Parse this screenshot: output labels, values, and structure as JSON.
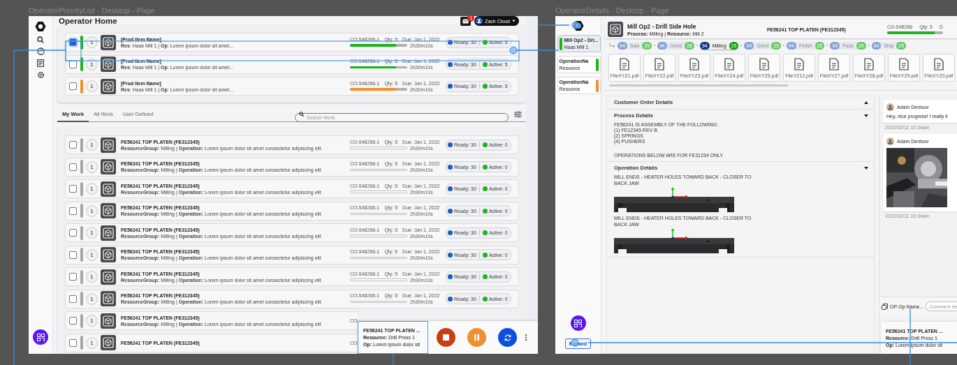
{
  "frames": [
    {
      "title": "OperatorPriorityList - Desktop - Page"
    },
    {
      "title": "OperatorDetails - Desktop - Page"
    }
  ],
  "home": {
    "header": {
      "title": "Operator Home",
      "mail_count": "1",
      "user": "Zach Cloud"
    },
    "priority_items": [
      {
        "checked": true,
        "color": "#1db31d",
        "number": "1",
        "name": "[Prod Item Name]",
        "detail": "**Res**: Haas Mill 1  |  **Op**: Lorem ipsum dolor sit amet...",
        "order": "CO-548266-1",
        "qty": "Qty: 5",
        "due": "Due: Jan 1, 2022",
        "level": 0.8,
        "time": "2h30m10s",
        "ready": "Ready: 30",
        "active": "Active: 5"
      },
      {
        "checked": false,
        "color": "#1db31d",
        "number": "1",
        "name": "[Prod Item Name]",
        "detail": "**Res**: Haas Mill 1  |  **Op**: Lorem ipsum dolor sit amet...",
        "order": "CO-548266-1",
        "qty": "Qty: 5",
        "due": "Due: Jan 1, 2022",
        "level": 0.8,
        "time": "2h30m10s",
        "ready": "Ready: 30",
        "active": "Active: 5"
      },
      {
        "checked": false,
        "color": "#f0902e",
        "number": "1",
        "name": "[Prod Item Name]",
        "detail": "**Res**: Haas Mill 1  |  **Op**: Lorem ipsum dolor sit amet...",
        "order": "CO-548266-1",
        "qty": "Qty: 5",
        "due": "Due: Jan 1, 2022",
        "level": 0.8,
        "time": "2h30m10s",
        "ready": "Ready: 30",
        "active": "Active: 5"
      }
    ],
    "tabs": [
      {
        "label": "My Work",
        "selected": true
      },
      {
        "label": "All Work",
        "selected": false
      },
      {
        "label": "User Defined",
        "selected": false
      }
    ],
    "search": {
      "placeholder": "Search Work"
    },
    "work_rows": [
      {
        "checked": false,
        "color": "#a6a6a6",
        "number": "1",
        "name": "FE56241 TOP PLATEN (FE312345)",
        "detail": "**ResourceGroup:** Milling  |  **Operation:** Lorem ipsum dolor sit amet consectetur adipiscing elit",
        "order": "CO-548266-1",
        "qty": "Qty: 5",
        "due": "Due: Jan 1, 2022",
        "level": 0,
        "time": "2h30m10s",
        "ready": "Ready: 30",
        "active": "Active: 0"
      },
      {
        "checked": false,
        "color": "#a6a6a6",
        "number": "1",
        "name": "FE56241 TOP PLATEN (FE312345)",
        "detail": "**ResourceGroup:** Milling  |  **Operation:** Lorem ipsum dolor sit amet consectetur adipiscing elit",
        "order": "CO-548266-1",
        "qty": "Qty: 5",
        "due": "Due: Jan 1, 2022",
        "level": 0,
        "time": "2h30m10s",
        "ready": "Ready: 30",
        "active": "Active: 0"
      },
      {
        "checked": false,
        "color": "#a6a6a6",
        "number": "1",
        "name": "FE56241 TOP PLATEN (FE312345)",
        "detail": "**ResourceGroup:** Milling  |  **Operation:** Lorem ipsum dolor sit amet consectetur adipiscing elit",
        "order": "CO-548266-1",
        "qty": "Qty: 5",
        "due": "Due: Jan 1, 2022",
        "level": 0,
        "time": "2h30m10s",
        "ready": "Ready: 30",
        "active": "Active: 0"
      },
      {
        "checked": false,
        "color": "#a6a6a6",
        "number": "1",
        "name": "FE56241 TOP PLATEN (FE312345)",
        "detail": "**ResourceGroup:** Milling  |  **Operation:** Lorem ipsum dolor sit amet consectetur adipiscing elit",
        "order": "CO-548266-1",
        "qty": "Qty: 5",
        "due": "Due: Jan 1, 2022",
        "level": 0,
        "time": "2h30m10s",
        "ready": "Ready: 30",
        "active": "Active: 0"
      },
      {
        "checked": false,
        "color": "#a6a6a6",
        "number": "1",
        "name": "FE56241 TOP PLATEN (FE312345)",
        "detail": "**ResourceGroup:** Milling  |  **Operation:** Lorem ipsum dolor sit amet consectetur adipiscing elit",
        "order": "CO-548266-1",
        "qty": "Qty: 5",
        "due": "Due: Jan 1, 2022",
        "level": 0,
        "time": "2h30m10s",
        "ready": "Ready: 30",
        "active": "Active: 0"
      },
      {
        "checked": false,
        "color": "#a6a6a6",
        "number": "1",
        "name": "FE56241 TOP PLATEN (FE312345)",
        "detail": "**ResourceGroup:** Milling  |  **Operation:** Lorem ipsum dolor sit amet consectetur adipiscing elit",
        "order": "CO-548266-1",
        "qty": "Qty: 5",
        "due": "Due: Jan 1, 2022",
        "level": 0,
        "time": "2h30m10s",
        "ready": "Ready: 30",
        "active": "Active: 0"
      },
      {
        "checked": false,
        "color": "#a6a6a6",
        "number": "1",
        "name": "FE56241 TOP PLATEN (FE312345)",
        "detail": "**ResourceGroup:** Milling  |  **Operation:** Lorem ipsum dolor sit amet consectetur adipiscing elit",
        "order": "CO-548266-1",
        "qty": "Qty: 5",
        "due": "Due: Jan 1, 2022",
        "level": 0,
        "time": "2h30m10s",
        "ready": "Ready: 30",
        "active": "Active: 0"
      },
      {
        "checked": false,
        "color": "#a6a6a6",
        "number": "1",
        "name": "FE56241 TOP PLATEN (FE312345)",
        "detail": "**ResourceGroup:** Milling  |  **Operation:** Lorem ipsum dolor sit amet consectetur adipiscing elit",
        "order": "CO-548266-1",
        "qty": "Qty: 5",
        "due": "Due: Jan 1, 2022",
        "level": 0,
        "time": "2h30m10s",
        "ready": "Ready: 30",
        "active": "Active: 0"
      },
      {
        "checked": false,
        "color": "#a6a6a6",
        "number": "1",
        "name": "FE56241 TOP PLATEN (FE312345)",
        "detail": "**ResourceGroup:** Milling  |  **Operation:** Lorem ipsum dolor sit amet consectetur adipiscing elit",
        "order": "CO"
      },
      {
        "checked": false,
        "color": "#a6a6a6",
        "number": "1",
        "name": "FE56241 TOP PLATEN (FE312345)",
        "order": "CO"
      }
    ],
    "active_job": {
      "title": "FE56241 TOP PLATEN ...",
      "resource": "**Resource:** Drill Press 1",
      "op": "**Op:** Lorem ipsum dolor sit"
    }
  },
  "details": {
    "operations": [
      {
        "title": "Mill Op2 - Dri...",
        "subtitle": "Haas Mill 1",
        "color": "#1db31d",
        "selected": true
      },
      {
        "title": "OperationNa",
        "subtitle": "Resource",
        "color": "#1db31d",
        "selected": false
      },
      {
        "title": "OperationNa",
        "subtitle": "Resource",
        "color": "#f0902e",
        "selected": false
      }
    ],
    "expand_label": "Expand",
    "header": {
      "title": "Mill Op2 - Drill Side Hole",
      "subtitle": "**Process:** Milling    |    **Resource:** Mill 2",
      "part": "FE56241 TOP PLATEN (FE312345)",
      "order": "CO-548266",
      "qty": "Qty: 5",
      "due": "D",
      "level": 0.85
    },
    "steps": [
      {
        "count": "94",
        "name": "Saw",
        "done": "25",
        "selected": false
      },
      {
        "count": "94",
        "name": "Grind",
        "done": "25",
        "selected": false
      },
      {
        "count": "94",
        "name": "Milling",
        "done": "25",
        "selected": true
      },
      {
        "count": "94",
        "name": "Grind",
        "done": "25",
        "selected": false
      },
      {
        "count": "94",
        "name": "Finish",
        "done": "25",
        "selected": false
      },
      {
        "count": "94",
        "name": "Pack",
        "done": "25",
        "selected": false
      },
      {
        "count": "94",
        "name": "Ship",
        "done": "25",
        "selected": false
      }
    ],
    "files": [
      "FileXYZ1.pdf",
      "FileXYZ2.pdf",
      "FileXYZ3.pdf",
      "FileXYZ4.pdf",
      "FileXYZ5.pdf",
      "FileYZ12.pdf",
      "FileXYZ7.pdf",
      "FileXYZ8.pdf",
      "FileXYZ9.pdf",
      "FileXYZ0.pdf"
    ],
    "sections": [
      {
        "title": "Customer Order Details",
        "expanded": false
      },
      {
        "title": "Process Details",
        "expanded": true,
        "lines": [
          "FE56241 IS ASSEMBLY OF THE FOLLOWING:",
          "(1) FE12345 REV B",
          "(2) SPRINGS",
          "(4) PUSHERS"
        ],
        "note": "OPERATIONS BELOW ARE FOR FE31234 ONLY"
      },
      {
        "title": "Operation Details",
        "expanded": true,
        "steps": [
          "MILL ENDS - HEATER HOLES TOWARD BACK - CLOSER TO BACK JAW",
          "MILL ENDS - HEATER HOLES TOWARD BACK - CLOSER TO BACK JAW"
        ]
      }
    ],
    "comments": [
      {
        "kind": "text",
        "author": "Adam Denisov",
        "text": "Hey, nice progress! I really li",
        "time": "2022/02/11 10:34am"
      },
      {
        "author": "Adam Denisov",
        "time": "2022/02/11 10:34am"
      }
    ],
    "composer": {
      "op_label": "OP-Op Name...",
      "placeholder": "Comment he"
    },
    "active_job": {
      "title": "FE56241 TOP PLATEN ...",
      "resource": "**Resource:** Drill Press 1",
      "op": "**Op:** Lorem ipsum dolor sit"
    }
  }
}
